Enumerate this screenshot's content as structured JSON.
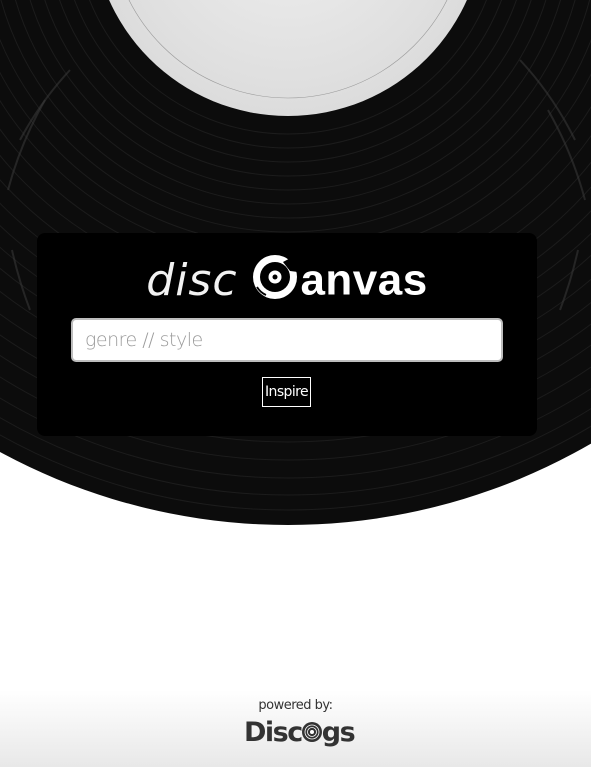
{
  "logo": {
    "left_text": "disc",
    "right_text": "anvas",
    "mark": "vinyl-record-c-icon"
  },
  "search": {
    "value": "",
    "placeholder": "genre // style"
  },
  "inspire_button": {
    "label": "Inspire"
  },
  "footer": {
    "powered_by": "powered by:",
    "brand_prefix": "Disc",
    "brand_suffix": "gs",
    "brand_icon": "discogs-record-icon"
  },
  "colors": {
    "panel": "#000000",
    "record": "#0d0d0d",
    "label": "#e6e6e6",
    "page": "#ffffff",
    "footer_text": "#333333"
  }
}
